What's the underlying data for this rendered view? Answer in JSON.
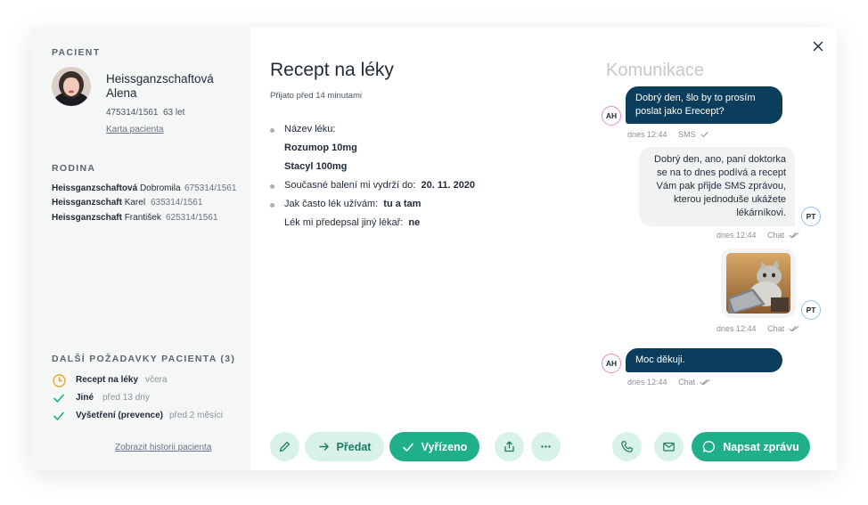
{
  "patient": {
    "section_label": "PACIENT",
    "surname": "Heissganzschaftová",
    "first_name": "Alena",
    "id": "475314/1561",
    "age": "63 let",
    "card_link": "Karta pacienta"
  },
  "family": {
    "section_label": "RODINA",
    "members": [
      {
        "surname": "Heissganzschaftová",
        "first_name": "Dobromila",
        "id": "675314/1561"
      },
      {
        "surname": "Heissganzschaft",
        "first_name": "Karel",
        "id": "635314/1561"
      },
      {
        "surname": "Heissganzschaft",
        "first_name": "František",
        "id": "625314/1561"
      }
    ]
  },
  "requests": {
    "section_label": "DALŠÍ POŽADAVKY PACIENTA (3)",
    "items": [
      {
        "name": "Recept na léky",
        "time": "včera",
        "status": "pending"
      },
      {
        "name": "Jiné",
        "time": "před 13 dny",
        "status": "done"
      },
      {
        "name": "Vyšetření (prevence)",
        "time": "před 2 měsíci",
        "status": "done"
      }
    ],
    "history_link": "Zobrazit historii pacienta"
  },
  "request": {
    "title": "Recept na léky",
    "received": "Přijato před 14 minutami",
    "drug_label": "Název léku:",
    "drugs": [
      "Rozumop 10mg",
      "Stacyl 100mg"
    ],
    "supply_label": "Současné balení mi vydrží do:",
    "supply_value": "20. 11. 2020",
    "frequency_label": "Jak často lék užívám:",
    "frequency_value": "tu a tam",
    "other_doctor_label": "Lék mi předepsal jiný lékař:",
    "other_doctor_value": "ne"
  },
  "actions": {
    "forward_label": "Předat",
    "resolve_label": "Vyřízeno"
  },
  "communication": {
    "title": "Komunikace",
    "messages": [
      {
        "sender": "AH",
        "text_line1": "Dobrý den, šlo by to prosím",
        "text_line2": "poslat jako Erecept?",
        "time": "dnes 12:44",
        "channel": "SMS"
      },
      {
        "sender": "PT",
        "lines": [
          "Dobrý den, ano, paní doktorka",
          "se na to dnes podívá a recept",
          "Vám pak přijde SMS zprávou,",
          "kterou jednoduše ukážete",
          "lékárníkovi."
        ],
        "time": "dnes 12:44",
        "channel": "Chat"
      },
      {
        "sender": "PT",
        "type": "image",
        "time": "dnes 12:44",
        "channel": "Chat"
      },
      {
        "sender": "AH",
        "text": "Moc děkuji.",
        "time": "dnes 12:44",
        "channel": "Chat"
      }
    ],
    "write_label": "Napsat zprávu"
  },
  "colors": {
    "accent": "#1fb08a",
    "accent_light": "#d8f2ea",
    "bubble_dark": "#0b3d5c",
    "pending": "#e5a53a"
  }
}
